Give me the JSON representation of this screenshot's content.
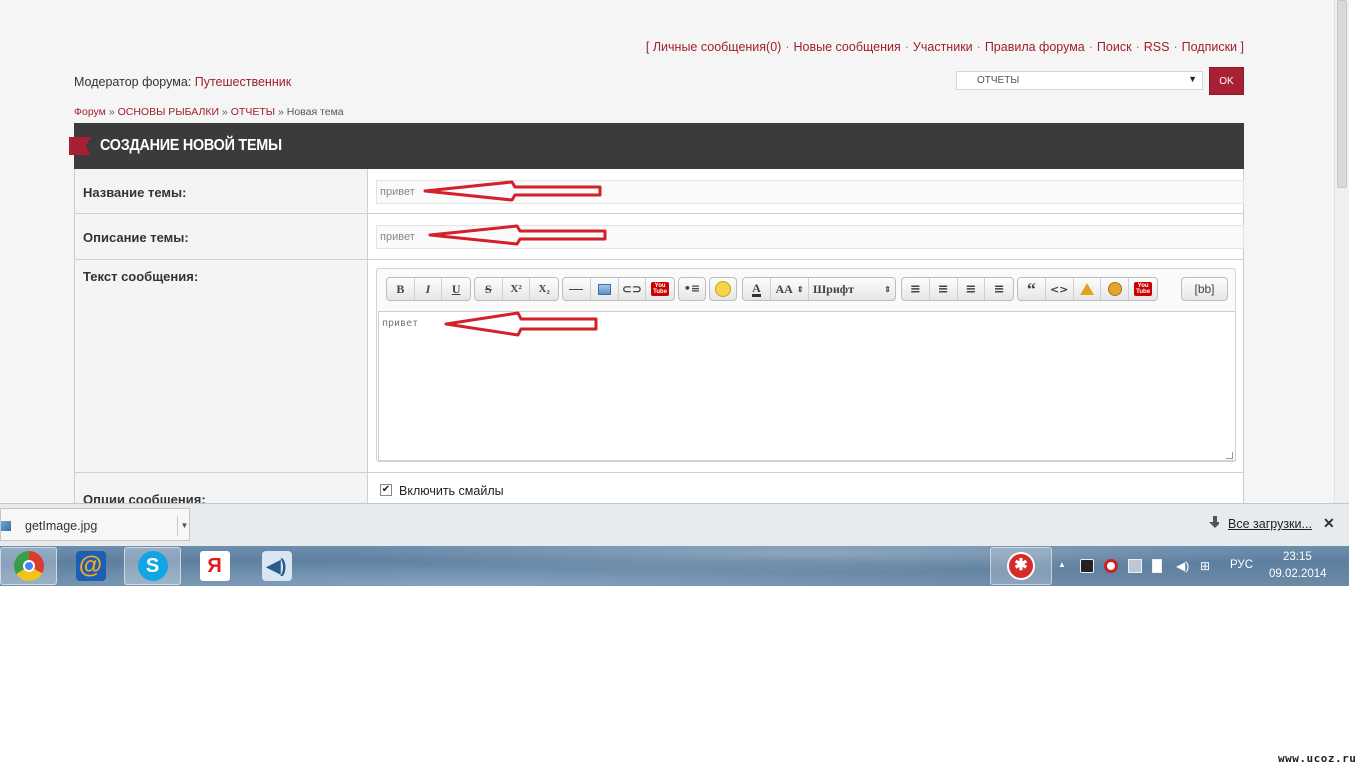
{
  "top_links": {
    "bracket_open": "[",
    "bracket_close": "]",
    "items": [
      "Личные сообщения(0)",
      "Новые сообщения",
      "Участники",
      "Правила форума",
      "Поиск",
      "RSS",
      "Подписки"
    ],
    "separator": "·"
  },
  "moderator": {
    "label": "Модератор форума:",
    "name": "Путешественник"
  },
  "forum_jump": {
    "selected": "ОТЧЕТЫ",
    "button": "OK"
  },
  "breadcrumb": {
    "items": [
      "Форум",
      "ОСНОВЫ РЫБАЛКИ",
      "ОТЧЕТЫ"
    ],
    "separator": "»",
    "current": "Новая тема"
  },
  "form": {
    "title": "СОЗДАНИЕ НОВОЙ ТЕМЫ",
    "topic_label": "Название темы:",
    "topic_value": "привет",
    "desc_label": "Описание темы:",
    "desc_value": "привет",
    "message_label": "Текст сообщения:",
    "message_value": "привет",
    "options_label": "Опции сообщения:",
    "option_smileys": "Включить смайлы"
  },
  "editor_toolbar": {
    "bold": "B",
    "italic": "I",
    "underline": "U",
    "strike": "S",
    "sup": "X²",
    "sub": "X₂",
    "size": "AA",
    "font": "Шрифт",
    "quote": "“",
    "code": "<>",
    "bb": "[bb]",
    "youtube_top": "You",
    "youtube_bottom": "Tube"
  },
  "download_bar": {
    "file_name": "getImage.jpg",
    "all_downloads": "Все загрузки..."
  },
  "taskbar": {
    "lang": "РУС",
    "time": "23:15",
    "date": "09.02.2014",
    "apps": [
      "chrome-icon",
      "mail-agent-icon",
      "skype-icon",
      "yandex-icon",
      "sound-icon"
    ]
  },
  "watermark": "www.ucoz.ru",
  "colors": {
    "accent": "#a82033",
    "header_bg": "#3b3b3b",
    "annotation_arrow": "#d3202a"
  }
}
